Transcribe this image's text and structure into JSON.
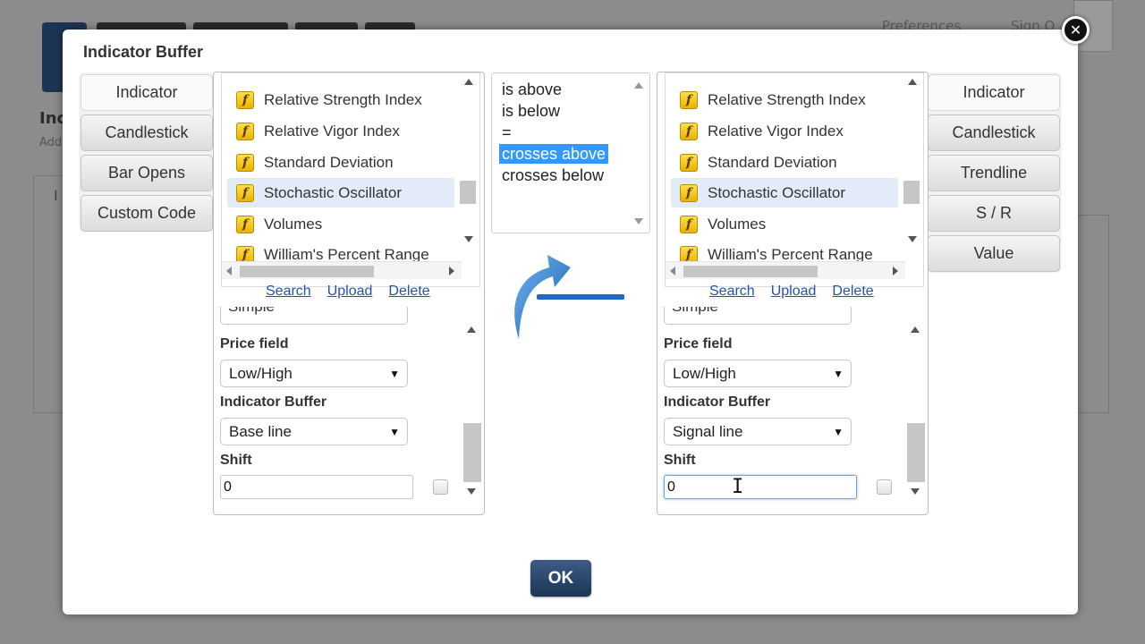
{
  "background": {
    "links": [
      "Preferences",
      "Sign O"
    ],
    "heading": "Inc",
    "subtext": "Add",
    "box_letter": "I"
  },
  "modal": {
    "title": "Indicator Buffer",
    "close_icon": "close-icon"
  },
  "left_buttons": [
    "Indicator",
    "Candlestick",
    "Bar Opens",
    "Custom Code"
  ],
  "right_buttons": [
    "Indicator",
    "Candlestick",
    "Trendline",
    "S / R",
    "Value"
  ],
  "indicator_list": {
    "items": [
      "Relative Strength Index",
      "Relative Vigor Index",
      "Standard Deviation",
      "Stochastic Oscillator",
      "Volumes",
      "William's Percent Range"
    ],
    "selected": "Stochastic Oscillator",
    "links": [
      "Search",
      "Upload",
      "Delete"
    ]
  },
  "left_panel": {
    "partial_select": "Simple",
    "price_field_label": "Price field",
    "price_field_value": "Low/High",
    "buffer_label": "Indicator Buffer",
    "buffer_value": "Base line",
    "shift_label": "Shift",
    "shift_value": "0"
  },
  "right_panel": {
    "partial_select": "Simple",
    "price_field_label": "Price field",
    "price_field_value": "Low/High",
    "buffer_label": "Indicator Buffer",
    "buffer_value": "Signal line",
    "shift_label": "Shift",
    "shift_value": "0"
  },
  "operators": {
    "items": [
      "is above",
      "is below",
      "=",
      "crosses above",
      "crosses below"
    ],
    "selected": "crosses above"
  },
  "ok_label": "OK",
  "colors": {
    "accent": "#3399ff",
    "ok_button": "#1c3556",
    "function_icon": "#f3c300",
    "arrow": "#2f7fd0"
  }
}
